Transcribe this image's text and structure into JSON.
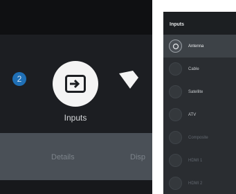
{
  "home_row": {
    "badge_count": "2",
    "selected_tile_label": "Inputs",
    "selected_tile_icon": "input-source-icon",
    "next_tile_icon": "partial-tile-icon"
  },
  "action_bar": {
    "details_label": "Details",
    "partial_label": "Disp"
  },
  "inputs_menu": {
    "title": "Inputs",
    "items": [
      {
        "label": "Antenna",
        "selected": true,
        "dim": false
      },
      {
        "label": "Cable",
        "selected": false,
        "dim": false
      },
      {
        "label": "Satellite",
        "selected": false,
        "dim": false
      },
      {
        "label": "ATV",
        "selected": false,
        "dim": false
      },
      {
        "label": "Composite",
        "selected": false,
        "dim": true
      },
      {
        "label": "HDMI 1",
        "selected": false,
        "dim": true
      },
      {
        "label": "HDMI 2",
        "selected": false,
        "dim": true
      }
    ]
  },
  "colors": {
    "accent_blue": "#1f6fb5",
    "panel_bg": "#2a2d31",
    "tile_white": "#f4f4f4"
  }
}
